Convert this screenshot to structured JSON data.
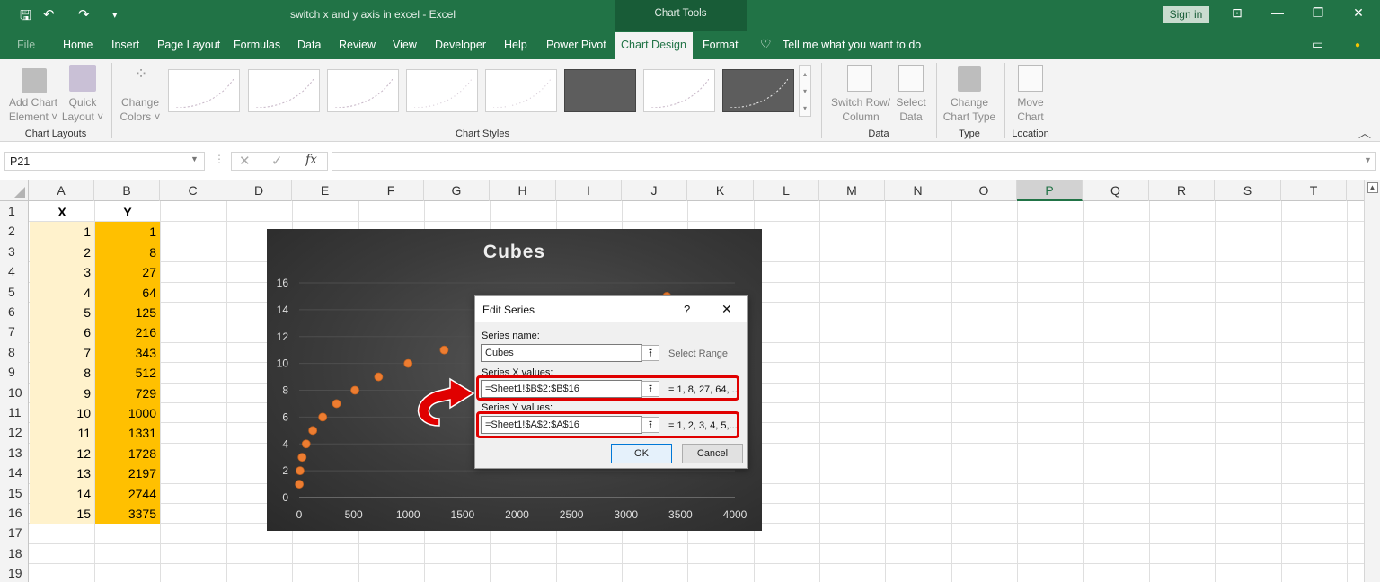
{
  "app": {
    "doc_title": "switch x and y axis in excel  -  Excel",
    "context_label": "Chart Tools",
    "sign_in": "Sign in"
  },
  "tabs": [
    "File",
    "Home",
    "Insert",
    "Page Layout",
    "Formulas",
    "Data",
    "Review",
    "View",
    "Developer",
    "Help",
    "Power Pivot",
    "Chart Design",
    "Format"
  ],
  "tell_me": "Tell me what you want to do",
  "ribbon": {
    "add_chart_element": [
      "Add Chart",
      "Element ˅"
    ],
    "quick_layout": [
      "Quick",
      "Layout ˅"
    ],
    "change_colors": [
      "Change",
      "Colors ˅"
    ],
    "switch_row_column": [
      "Switch Row/",
      "Column"
    ],
    "select_data": [
      "Select",
      "Data"
    ],
    "change_chart_type": [
      "Change",
      "Chart Type"
    ],
    "move_chart": [
      "Move",
      "Chart"
    ],
    "groups": {
      "chart_layouts": "Chart Layouts",
      "chart_styles": "Chart Styles",
      "data": "Data",
      "type": "Type",
      "location": "Location"
    }
  },
  "formula_bar": {
    "name_box": "P21",
    "fx": "fx",
    "formula": ""
  },
  "columns": [
    "A",
    "B",
    "C",
    "D",
    "E",
    "F",
    "G",
    "H",
    "I",
    "J",
    "K",
    "L",
    "M",
    "N",
    "O",
    "P",
    "Q",
    "R",
    "S",
    "T"
  ],
  "selected_column": "P",
  "rows": [
    "1",
    "2",
    "3",
    "4",
    "5",
    "6",
    "7",
    "8",
    "9",
    "10",
    "11",
    "12",
    "13",
    "14",
    "15",
    "16",
    "17",
    "18",
    "19"
  ],
  "sheet": {
    "header_x": "X",
    "header_y": "Y",
    "x_values": [
      "1",
      "2",
      "3",
      "4",
      "5",
      "6",
      "7",
      "8",
      "9",
      "10",
      "11",
      "12",
      "13",
      "14",
      "15"
    ],
    "y_values": [
      "1",
      "8",
      "27",
      "64",
      "125",
      "216",
      "343",
      "512",
      "729",
      "1000",
      "1331",
      "1728",
      "2197",
      "2744",
      "3375"
    ]
  },
  "chart_data": {
    "type": "scatter",
    "title": "Cubes",
    "x": [
      1,
      8,
      27,
      64,
      125,
      216,
      343,
      512,
      729,
      1000,
      1331,
      1728,
      2197,
      2744,
      3375
    ],
    "y": [
      1,
      2,
      3,
      4,
      5,
      6,
      7,
      8,
      9,
      10,
      11,
      12,
      13,
      14,
      15
    ],
    "xlim": [
      0,
      4000
    ],
    "ylim": [
      0,
      16
    ],
    "x_ticks": [
      "0",
      "500",
      "1000",
      "1500",
      "2000",
      "2500",
      "3000",
      "3500",
      "4000"
    ],
    "y_ticks": [
      "0",
      "2",
      "4",
      "6",
      "8",
      "10",
      "12",
      "14",
      "16"
    ],
    "grid": true,
    "marker_color": "#ed7d31"
  },
  "dialog": {
    "title": "Edit Series",
    "help": "?",
    "close": "✕",
    "series_name_label": "Series name:",
    "series_name_value": "Cubes",
    "select_range": "Select Range",
    "x_label": "Series X values:",
    "x_value": "=Sheet1!$B$2:$B$16",
    "x_preview": "= 1, 8, 27, 64, ...",
    "y_label": "Series Y values:",
    "y_value": "=Sheet1!$A$2:$A$16",
    "y_preview": "= 1, 2, 3, 4, 5,...",
    "ok": "OK",
    "cancel": "Cancel"
  },
  "colors": {
    "excel_green": "#217346",
    "highlight_red": "#e00000",
    "x_fill": "#fff2cc",
    "y_fill": "#ffc000"
  }
}
